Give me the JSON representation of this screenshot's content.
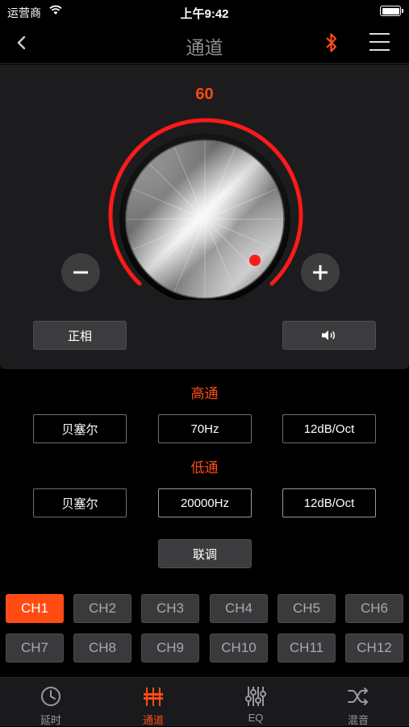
{
  "status_bar": {
    "carrier": "运营商",
    "time": "上午9:42"
  },
  "nav": {
    "title": "通道",
    "back_icon": "chevron-left-icon",
    "bluetooth_icon": "bluetooth-icon",
    "menu_icon": "hamburger-menu-icon"
  },
  "colors": {
    "accent": "#ff4b14",
    "panel": "#1c1c1e",
    "button": "#3c3c3e"
  },
  "volume": {
    "value": "60",
    "level": 60
  },
  "phase_button": "正相",
  "mute_button_icon": "speaker-icon",
  "highpass": {
    "label": "高通",
    "filter_type": "贝塞尔",
    "frequency": "70Hz",
    "slope": "12dB/Oct"
  },
  "lowpass": {
    "label": "低通",
    "filter_type": "贝塞尔",
    "frequency": "20000Hz",
    "slope": "12dB/Oct"
  },
  "link_button": "联调",
  "channels": [
    "CH1",
    "CH2",
    "CH3",
    "CH4",
    "CH5",
    "CH6",
    "CH7",
    "CH8",
    "CH9",
    "CH10",
    "CH11",
    "CH12"
  ],
  "selected_channel": "CH1",
  "tabs": [
    {
      "label": "延时",
      "icon": "clock-icon"
    },
    {
      "label": "通道",
      "icon": "channel-bars-icon",
      "active": true
    },
    {
      "label": "EQ",
      "icon": "eq-sliders-icon"
    },
    {
      "label": "混音",
      "icon": "shuffle-icon"
    }
  ]
}
